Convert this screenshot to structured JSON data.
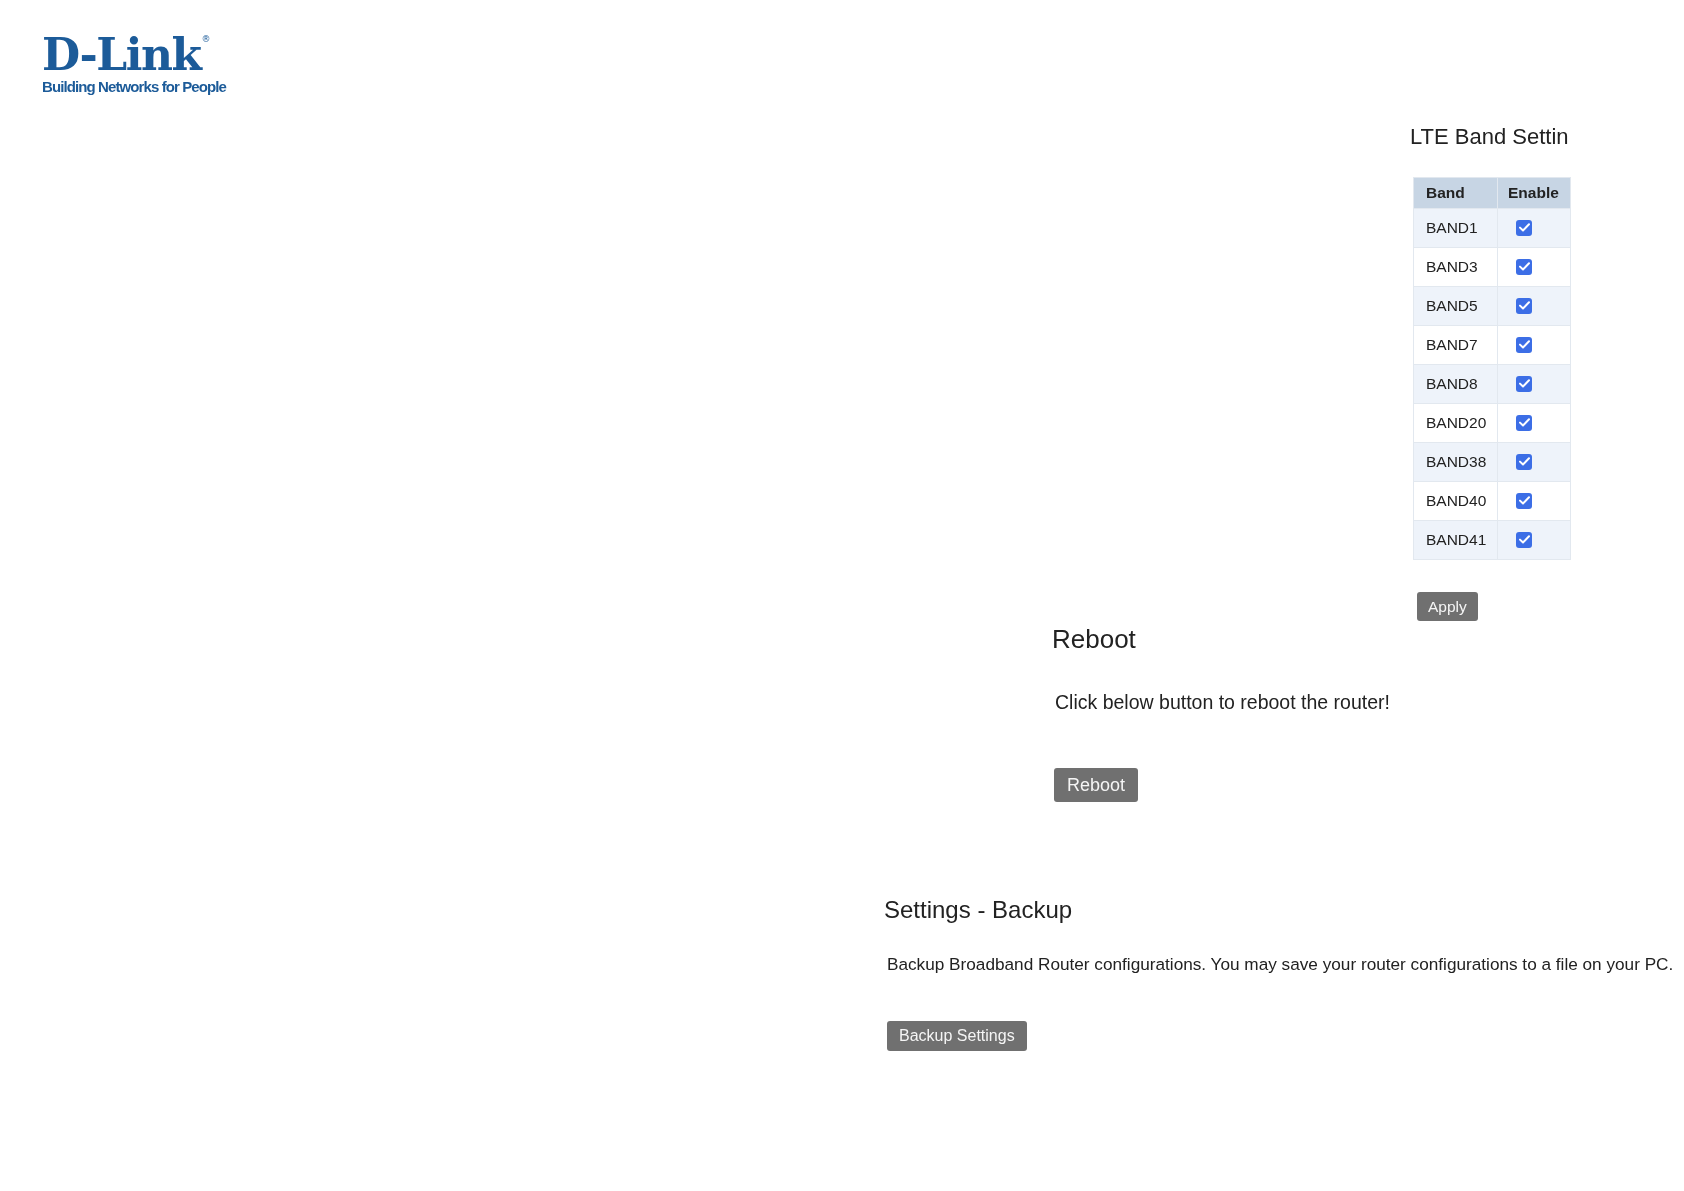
{
  "logo": {
    "name": "D-Link",
    "mark": "®",
    "tagline": "Building Networks for People"
  },
  "lte_band_settings": {
    "title": "LTE Band Settin",
    "columns": [
      "Band",
      "Enable"
    ],
    "bands": [
      {
        "name": "BAND1",
        "checked": true
      },
      {
        "name": "BAND3",
        "checked": true
      },
      {
        "name": "BAND5",
        "checked": true
      },
      {
        "name": "BAND7",
        "checked": true
      },
      {
        "name": "BAND8",
        "checked": true
      },
      {
        "name": "BAND20",
        "checked": true
      },
      {
        "name": "BAND38",
        "checked": true
      },
      {
        "name": "BAND40",
        "checked": true
      },
      {
        "name": "BAND41",
        "checked": true
      }
    ],
    "apply_button": "Apply"
  },
  "reboot": {
    "title": "Reboot",
    "text": "Click below button to reboot the router!",
    "button": "Reboot"
  },
  "backup": {
    "title": "Settings - Backup",
    "text": "Backup Broadband Router configurations. You may save your router configurations to a file on your PC.",
    "button": "Backup Settings"
  }
}
